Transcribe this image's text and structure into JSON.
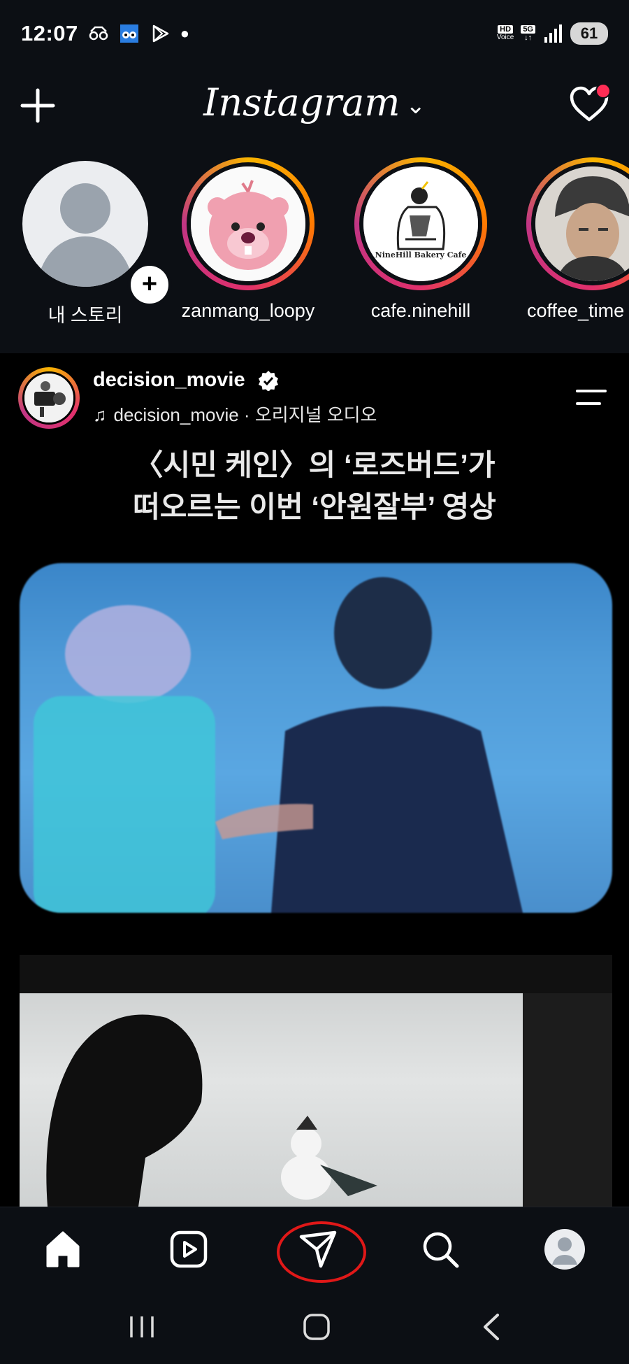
{
  "status": {
    "time": "12:07",
    "battery": "61",
    "network": "5G",
    "hd": "HD",
    "hd_sub": "Voice"
  },
  "header": {
    "title": "Instagram",
    "chevron": "⌄",
    "has_notification": true
  },
  "stories": [
    {
      "label": "내 스토리",
      "type": "own"
    },
    {
      "label": "zanmang_loopy"
    },
    {
      "label": "cafe.ninehill",
      "logo_text": "NineHill Bakery Cafe"
    },
    {
      "label": "coffee_time"
    }
  ],
  "post": {
    "username": "decision_movie",
    "verified": true,
    "audio": "decision_movie · 오리지널 오디오",
    "caption_line1": "〈시민 케인〉의 ‘로즈버드’가",
    "caption_line2": "떠오르는 이번 ‘안원잘부’ 영상"
  },
  "tabs": [
    "home-icon",
    "reels-icon",
    "direct-message-icon",
    "search-icon",
    "profile-icon"
  ],
  "highlighted_tab": "direct-message-icon",
  "colors": {
    "background": "#0c0f14",
    "story_ring_start": "#f8b400",
    "story_ring_end": "#c13584",
    "notification": "#ff2d55",
    "highlight": "#e01818"
  }
}
